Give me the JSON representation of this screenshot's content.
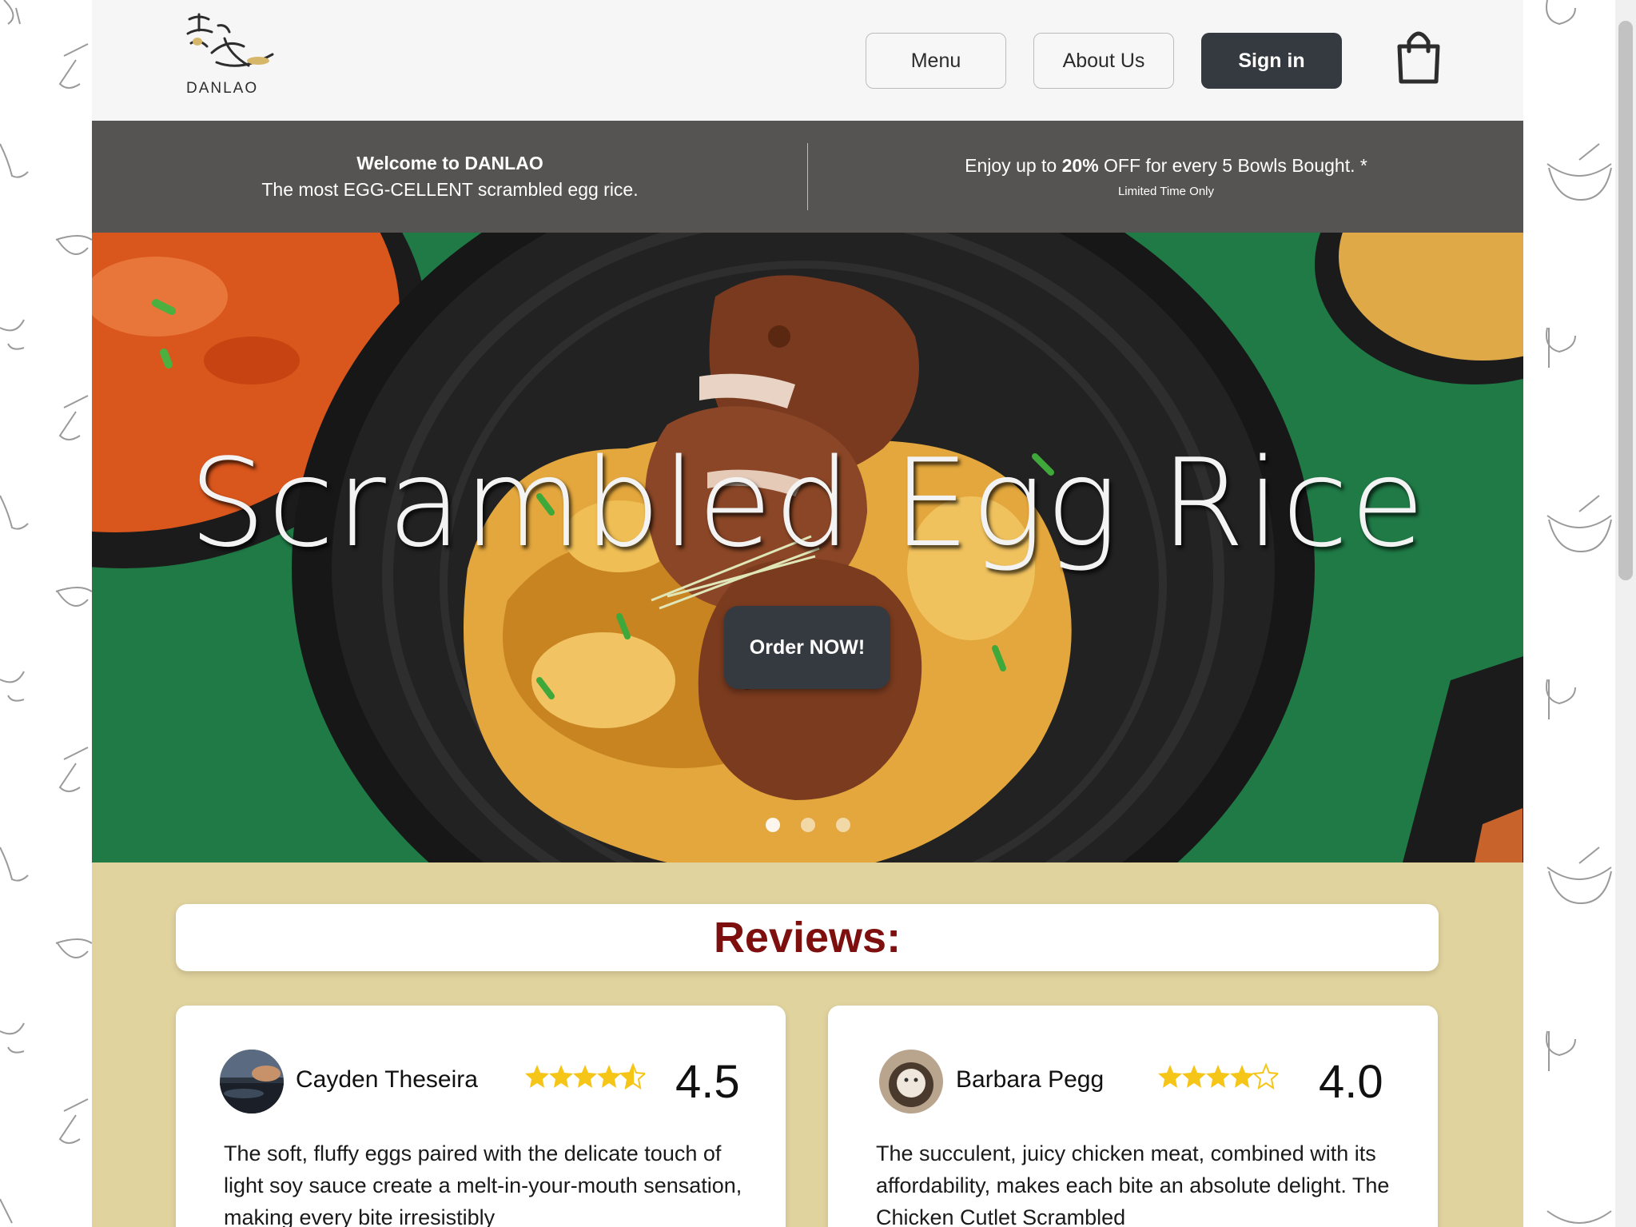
{
  "header": {
    "logo_text": "DANLAO",
    "nav": {
      "menu_label": "Menu",
      "about_label": "About Us",
      "signin_label": "Sign in"
    },
    "cart_icon": "shopping-bag-icon"
  },
  "promo": {
    "welcome": "Welcome to DANLAO",
    "tagline": "The most EGG-CELLENT scrambled egg rice.",
    "offer_prefix": "Enjoy up to ",
    "offer_bold": "20%",
    "offer_suffix": " OFF for every 5 Bowls Bought. *",
    "limited": "Limited Time Only"
  },
  "hero": {
    "title": "Scrambled Egg Rice",
    "cta_label": "Order NOW!",
    "slides": 3,
    "active_slide": 1
  },
  "reviews": {
    "heading": "Reviews:",
    "items": [
      {
        "name": "Cayden Theseira",
        "rating_text": "4.5",
        "rating": 4.5,
        "text": "The soft, fluffy eggs paired with the delicate touch of light soy sauce create a melt-in-your-mouth sensation, making every bite irresistibly"
      },
      {
        "name": "Barbara Pegg",
        "rating_text": "4.0",
        "rating": 4.0,
        "text": "The succulent, juicy chicken meat, combined with its affordability, makes each bite an absolute delight. The Chicken Cutlet Scrambled"
      }
    ]
  },
  "colors": {
    "header_bg": "#f5f6f5",
    "promo_bg": "#555453",
    "dark_button": "#343a40",
    "reviews_bg": "#e1d39e",
    "reviews_heading": "#7e0f0f",
    "star": "#f5c518"
  }
}
